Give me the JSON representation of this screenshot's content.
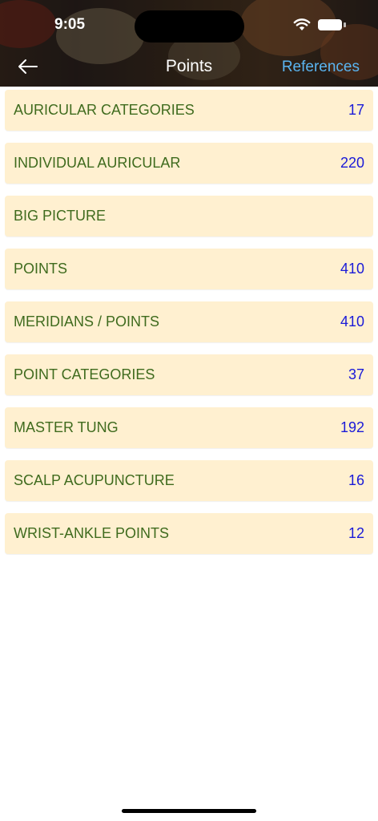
{
  "status_bar": {
    "time": "9:05"
  },
  "nav": {
    "title": "Points",
    "references_label": "References"
  },
  "items": [
    {
      "label": "AURICULAR CATEGORIES",
      "count": "17"
    },
    {
      "label": "INDIVIDUAL AURICULAR",
      "count": "220"
    },
    {
      "label": "BIG PICTURE",
      "count": ""
    },
    {
      "label": "POINTS",
      "count": "410"
    },
    {
      "label": "MERIDIANS / POINTS",
      "count": "410"
    },
    {
      "label": "POINT CATEGORIES",
      "count": "37"
    },
    {
      "label": "MASTER TUNG",
      "count": "192"
    },
    {
      "label": "SCALP ACUPUNCTURE",
      "count": "16"
    },
    {
      "label": "WRIST-ANKLE POINTS",
      "count": "12"
    }
  ],
  "colors": {
    "row_background": "#fff0d0",
    "label_text": "#3f6b1e",
    "count_text": "#1a1ad8",
    "link": "#5ab4f0"
  }
}
